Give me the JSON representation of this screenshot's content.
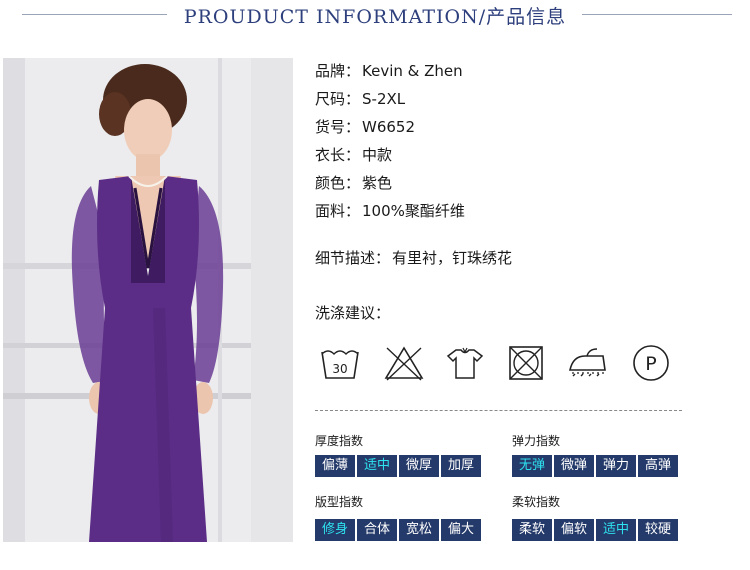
{
  "header": {
    "title": "PROUDUCT INFORMATION/产品信息"
  },
  "specs": [
    {
      "key": "品牌：",
      "value": "Kevin & Zhen"
    },
    {
      "key": "尺码：",
      "value": "S-2XL"
    },
    {
      "key": "货号：",
      "value": "W6652"
    },
    {
      "key": "衣长：",
      "value": "中款"
    },
    {
      "key": "颜色：",
      "value": "紫色"
    },
    {
      "key": "面料：",
      "value": "100%聚酯纤维"
    }
  ],
  "detail": {
    "key": "细节描述：",
    "value": "有里衬，钉珠绣花"
  },
  "care": {
    "label": "洗涤建议：",
    "icons": [
      {
        "name": "wash-30-icon",
        "text": "30"
      },
      {
        "name": "do-not-bleach-icon"
      },
      {
        "name": "dry-flat-icon"
      },
      {
        "name": "do-not-tumble-dry-icon"
      },
      {
        "name": "iron-low-icon"
      },
      {
        "name": "dry-clean-p-icon",
        "text": "P"
      }
    ]
  },
  "indices": [
    {
      "title": "厚度指数",
      "options": [
        "偏薄",
        "适中",
        "微厚",
        "加厚"
      ],
      "selected": 1
    },
    {
      "title": "弹力指数",
      "options": [
        "无弹",
        "微弹",
        "弹力",
        "高弹"
      ],
      "selected": 0
    },
    {
      "title": "版型指数",
      "options": [
        "修身",
        "合体",
        "宽松",
        "偏大"
      ],
      "selected": 0
    },
    {
      "title": "柔软指数",
      "options": [
        "柔软",
        "偏软",
        "适中",
        "较硬"
      ],
      "selected": 2
    }
  ],
  "colors": {
    "index_bg": "#243a6a",
    "index_selected": "#2ee2f0",
    "header": "#2d3f7c",
    "dress": "#5b2d86"
  }
}
